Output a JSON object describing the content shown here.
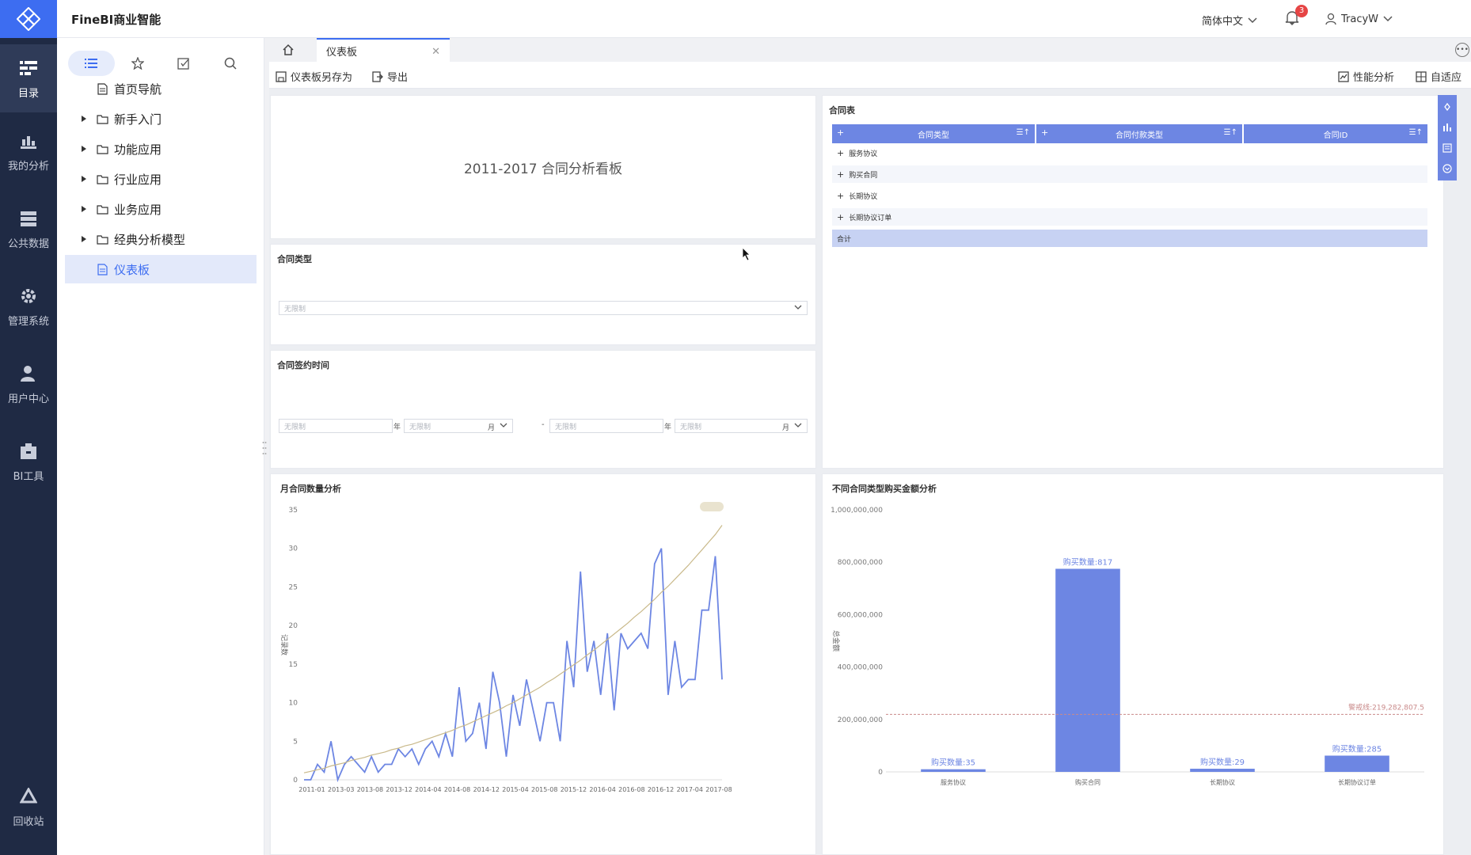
{
  "app": {
    "title": "FineBI商业智能"
  },
  "nav": {
    "items": [
      {
        "label": "目录",
        "icon": "catalog-icon"
      },
      {
        "label": "我的分析",
        "icon": "analysis-icon"
      },
      {
        "label": "公共数据",
        "icon": "database-icon"
      },
      {
        "label": "管理系统",
        "icon": "gear-icon"
      },
      {
        "label": "用户中心",
        "icon": "user-group-icon"
      },
      {
        "label": "BI工具",
        "icon": "toolbox-icon"
      },
      {
        "label": "回收站",
        "icon": "recycle-icon"
      }
    ]
  },
  "header": {
    "language": "简体中文",
    "notification_count": "3",
    "username": "TracyW"
  },
  "directory": {
    "tabs": [
      "list-icon",
      "star-icon",
      "edit-icon",
      "search-icon"
    ],
    "items": [
      {
        "label": "首页导航",
        "type": "file"
      },
      {
        "label": "新手入门",
        "type": "folder"
      },
      {
        "label": "功能应用",
        "type": "folder"
      },
      {
        "label": "行业应用",
        "type": "folder"
      },
      {
        "label": "业务应用",
        "type": "folder"
      },
      {
        "label": "经典分析模型",
        "type": "folder"
      },
      {
        "label": "仪表板",
        "type": "file"
      }
    ]
  },
  "tabs": {
    "active": "仪表板"
  },
  "toolbar": {
    "save_as": "仪表板另存为",
    "export": "导出",
    "performance": "性能分析",
    "adaptive": "自适应"
  },
  "dashboard": {
    "title": "2011-2017 合同分析看板",
    "filter_type": {
      "title": "合同类型",
      "placeholder": "无限制"
    },
    "filter_time": {
      "title": "合同签约时间",
      "placeholder": "无限制",
      "year": "年",
      "month": "月",
      "separator": "-"
    },
    "table": {
      "title": "合同表",
      "headers": [
        "合同类型",
        "合同付款类型",
        "合同ID"
      ],
      "rows": [
        "服务协议",
        "购买合同",
        "长期协议",
        "长期协议订单"
      ],
      "total_label": "合计"
    }
  },
  "chart_data": [
    {
      "type": "line",
      "title": "月合同数量分析",
      "ylabel": "记录数",
      "ylim": [
        0,
        35
      ],
      "yticks": [
        0,
        5,
        10,
        15,
        20,
        25,
        30,
        35
      ],
      "xtick_labels": [
        "2011-01",
        "2013-03",
        "2013-08",
        "2013-12",
        "2014-04",
        "2014-08",
        "2014-12",
        "2015-04",
        "2015-08",
        "2015-12",
        "2016-04",
        "2016-08",
        "2016-12",
        "2017-04",
        "2017-08"
      ],
      "series": [
        {
          "values": [
            0,
            0,
            2,
            1,
            5,
            0,
            2,
            3,
            2,
            1,
            3,
            1,
            2,
            2,
            4,
            3,
            4,
            2,
            4,
            5,
            3,
            6,
            3,
            12,
            5,
            6,
            10,
            4,
            14,
            10,
            3,
            11,
            7,
            13,
            9,
            5,
            10,
            10,
            5,
            18,
            12,
            27,
            14,
            18,
            11,
            19,
            9,
            19,
            17,
            18,
            19,
            17,
            28,
            30,
            11,
            18,
            12,
            13,
            13,
            22,
            22,
            29,
            13
          ],
          "color": "#6d86e3"
        },
        {
          "values": [
            0.9,
            1.1,
            1.3,
            1.5,
            1.8,
            2.0,
            2.2,
            2.5,
            2.7,
            2.9,
            3.2,
            3.4,
            3.6,
            3.9,
            4.1,
            4.4,
            4.6,
            4.9,
            5.2,
            5.5,
            5.8,
            6.1,
            6.4,
            6.8,
            7.1,
            7.5,
            7.9,
            8.3,
            8.7,
            9.1,
            9.6,
            10.0,
            10.5,
            11.0,
            11.5,
            12.0,
            12.6,
            13.1,
            13.7,
            14.3,
            14.9,
            15.5,
            16.2,
            16.8,
            17.5,
            18.2,
            18.9,
            19.6,
            20.3,
            21.1,
            21.8,
            22.6,
            23.4,
            24.3,
            25.1,
            26.0,
            26.9,
            27.8,
            28.8,
            29.8,
            30.8,
            31.8,
            33.0
          ],
          "color": "#c9b98a"
        }
      ]
    },
    {
      "type": "bar",
      "title": "不同合同类型购买金额分析",
      "ylabel": "总金额",
      "ylim": [
        0,
        1000000000
      ],
      "ytick_labels": [
        "0",
        "200,000,000",
        "400,000,000",
        "600,000,000",
        "800,000,000",
        "1,000,000,000"
      ],
      "categories": [
        "服务协议",
        "购买合同",
        "长期协议",
        "长期协议订单"
      ],
      "values": [
        10000000,
        775000000,
        12000000,
        62000000
      ],
      "data_labels": [
        "购买数量:35",
        "购买数量:817",
        "购买数量:29",
        "购买数量:285"
      ],
      "reference_line": {
        "value": 219282807.5,
        "label": "警戒线:219,282,807.5"
      },
      "color": "#6d86e3"
    }
  ]
}
